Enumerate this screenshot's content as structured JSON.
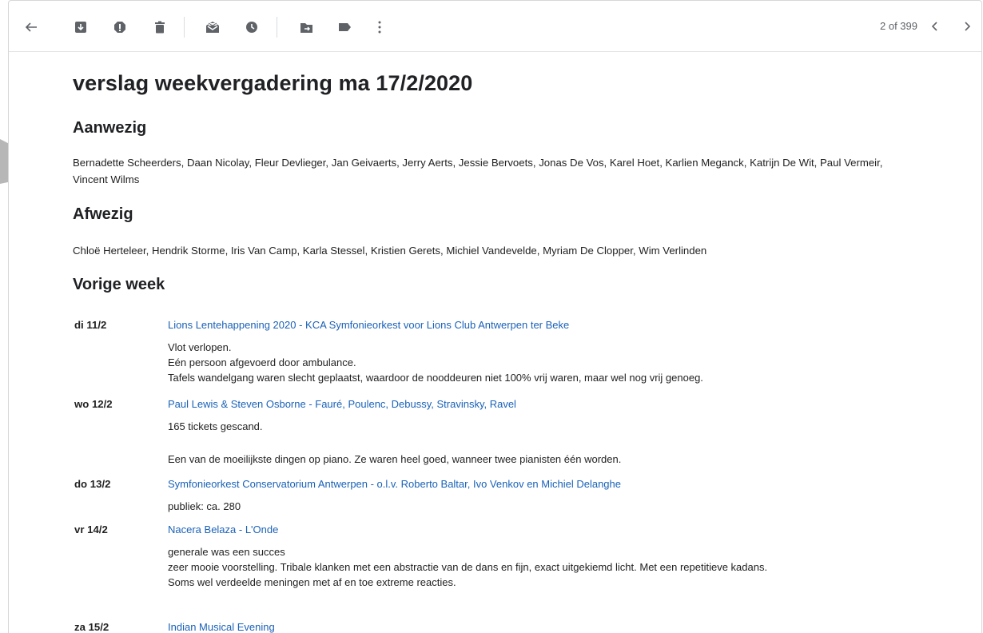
{
  "toolbar": {
    "back_icon": "arrow-left-icon",
    "actions": [
      {
        "name": "archive-icon"
      },
      {
        "name": "report-spam-icon"
      },
      {
        "name": "delete-icon"
      },
      {
        "name": "mark-unread-icon"
      },
      {
        "name": "snooze-icon"
      },
      {
        "name": "move-to-icon"
      },
      {
        "name": "label-icon"
      },
      {
        "name": "more-options-icon"
      }
    ],
    "counter": "2 of 399",
    "prev_icon": "chevron-left-icon",
    "next_icon": "chevron-right-icon"
  },
  "email": {
    "title": "verslag weekvergadering ma 17/2/2020",
    "sections": {
      "present_heading": "Aanwezig",
      "present_line1": "Bernadette Scheerders, Daan Nicolay, Fleur Devlieger, Jan Geivaerts, Jerry Aerts, Jessie Bervoets, Jonas De Vos, Karel Hoet, Karlien Meganck, Katrijn De Wit, Paul Vermeir,",
      "present_line2": "Vincent Wilms",
      "absent_heading": "Afwezig",
      "absent_text": "Chloë Herteleer, Hendrik Storme, Iris Van Camp, Karla Stessel, Kristien Gerets, Michiel Vandevelde, Myriam De Clopper, Wim Verlinden",
      "previous_heading": "Vorige week"
    },
    "events": [
      {
        "date": "di 11/2",
        "title": "Lions Lentehappening 2020 - KCA Symfonieorkest voor Lions Club Antwerpen ter Beke",
        "notes": [
          "Vlot verlopen.",
          "Eén persoon afgevoerd door ambulance.",
          "Tafels wandelgang waren slecht geplaatst, waardoor de nooddeuren niet 100% vrij waren, maar wel nog vrij genoeg."
        ]
      },
      {
        "date": "wo 12/2",
        "title": "Paul Lewis & Steven Osborne - Fauré, Poulenc, Debussy, Stravinsky, Ravel",
        "notes": [
          "165 tickets gescand.",
          "Een van de moeilijkste dingen op piano. Ze waren heel goed, wanneer twee pianisten één worden."
        ]
      },
      {
        "date": "do 13/2",
        "title": "Symfonieorkest Conservatorium Antwerpen - o.l.v. Roberto Baltar, Ivo Venkov en Michiel Delanghe",
        "notes": [
          "publiek: ca. 280"
        ]
      },
      {
        "date": "vr 14/2",
        "title": "Nacera Belaza - L'Onde",
        "notes": [
          "generale was een succes",
          "zeer mooie voorstelling. Tribale klanken met een abstractie van de dans en fijn, exact uitgekiemd licht. Met een repetitieve kadans.",
          "Soms wel verdeelde meningen met af en toe extreme reacties."
        ]
      },
      {
        "date": "za 15/2",
        "title": "Indian Musical Evening",
        "notes": []
      }
    ]
  },
  "colors": {
    "link": "#1a62b8",
    "icon": "#5f6368",
    "text": "#202124"
  }
}
